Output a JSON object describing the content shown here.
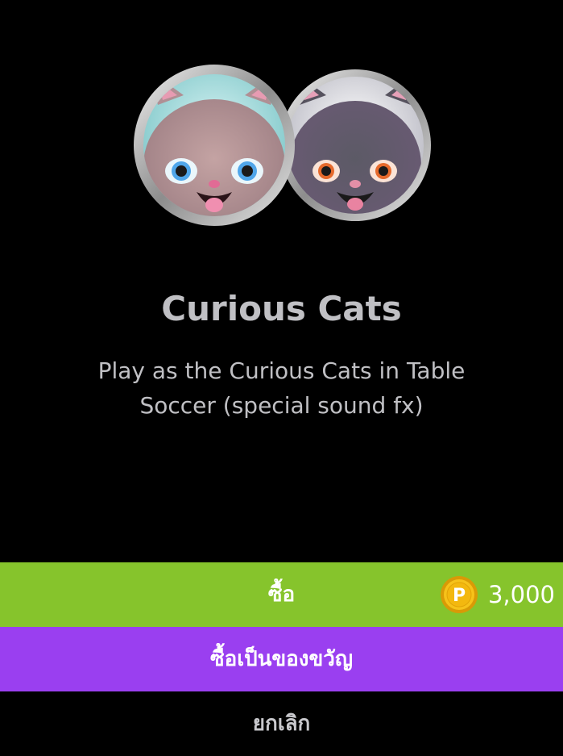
{
  "product": {
    "title": "Curious Cats",
    "description": "Play as the Curious Cats in Table Soccer (special sound fx)",
    "icons": [
      "pink-cat-avatar-icon",
      "grey-cat-avatar-icon"
    ]
  },
  "actions": {
    "buy_label": "ซื้อ",
    "price": "3,000",
    "currency_icon": "coin-p-icon",
    "gift_label": "ซื้อเป็นของขวัญ",
    "cancel_label": "ยกเลิก"
  },
  "colors": {
    "background": "#000000",
    "buy": "#86c42c",
    "gift": "#9a3ff0",
    "text": "#c0c0c4",
    "coin": "#f3b80f"
  }
}
